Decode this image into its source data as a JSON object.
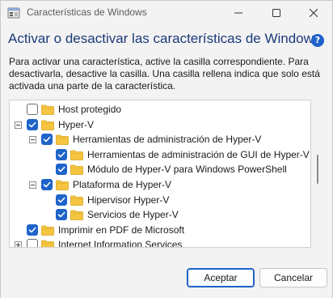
{
  "window": {
    "title": "Características de Windows",
    "heading": "Activar o desactivar las características de Windows",
    "description": "Para activar una característica, active la casilla correspondiente. Para desactivarla, desactive la casilla. Una casilla rellena indica que solo está activada una parte de la característica.",
    "help_icon": "?"
  },
  "features": [
    {
      "label": "Host protegido",
      "checked": false,
      "expander": "none"
    },
    {
      "label": "Hyper-V",
      "checked": true,
      "expander": "minus"
    },
    {
      "label": "Herramientas de administración de Hyper-V",
      "checked": true,
      "expander": "minus"
    },
    {
      "label": "Herramientas de administración de GUI de Hyper-V",
      "checked": true,
      "expander": "none"
    },
    {
      "label": "Módulo de Hyper-V para Windows PowerShell",
      "checked": true,
      "expander": "none"
    },
    {
      "label": "Plataforma de Hyper-V",
      "checked": true,
      "expander": "minus"
    },
    {
      "label": "Hipervisor Hyper-V",
      "checked": true,
      "expander": "none"
    },
    {
      "label": "Servicios de Hyper-V",
      "checked": true,
      "expander": "none"
    },
    {
      "label": "Imprimir en PDF de Microsoft",
      "checked": true,
      "expander": "none"
    },
    {
      "label": "Internet Information Services",
      "checked": false,
      "expander": "plus"
    }
  ],
  "buttons": {
    "accept": "Aceptar",
    "cancel": "Cancelar"
  },
  "icons": {
    "app": "windows-features-icon",
    "minimize": "minimize-icon",
    "maximize": "maximize-icon",
    "close": "close-icon",
    "folder": "folder-icon",
    "check": "checkmark-icon"
  },
  "colors": {
    "accent": "#1e63c9",
    "heading": "#1b3a78",
    "folder": "#f5c542"
  }
}
